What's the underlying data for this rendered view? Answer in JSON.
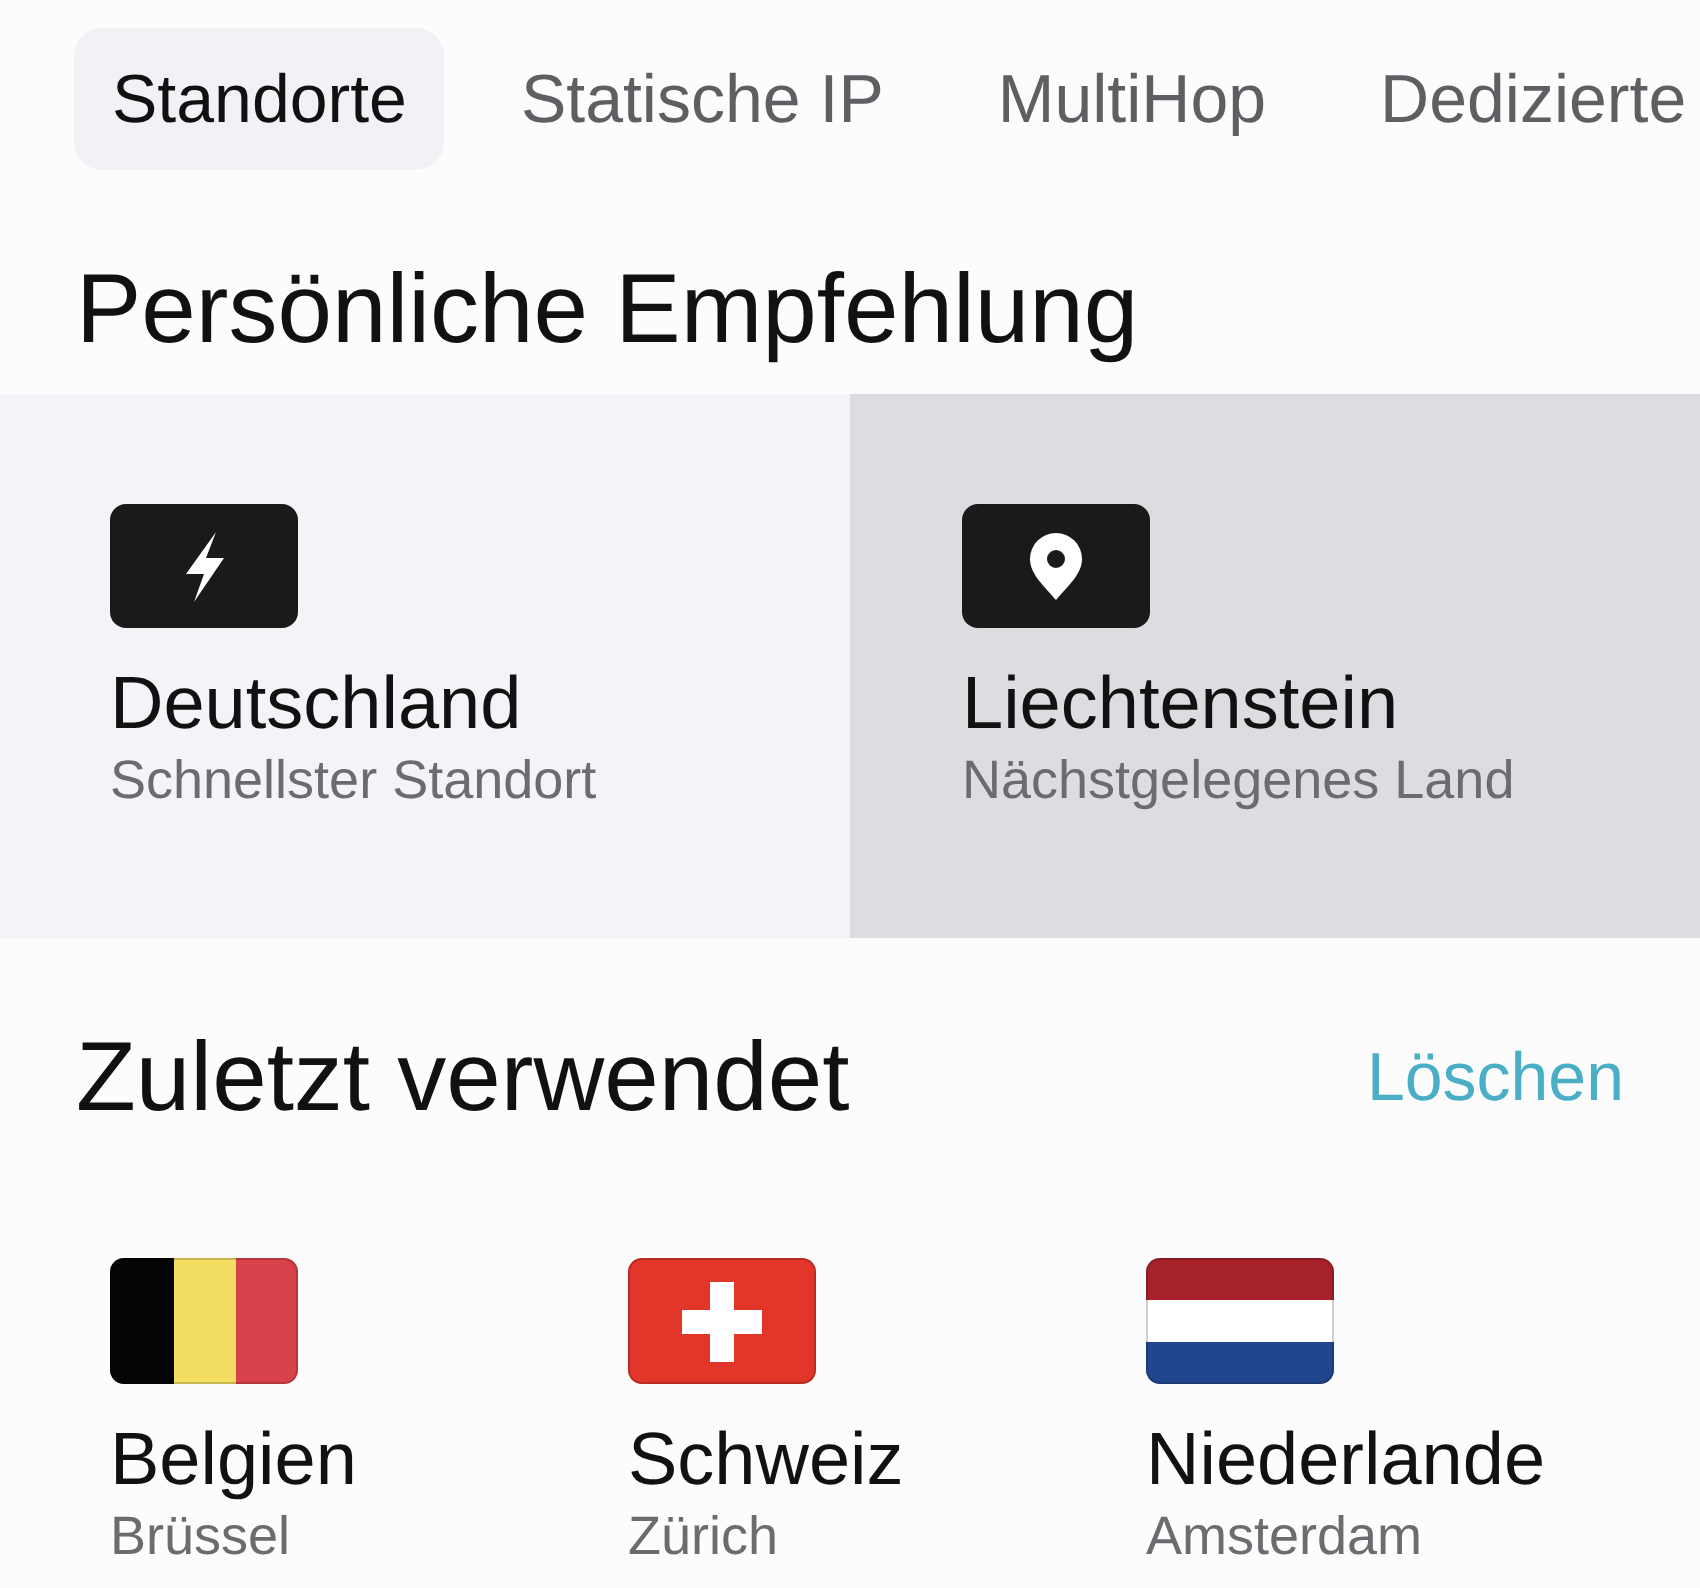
{
  "tabs": [
    {
      "label": "Standorte",
      "selected": true
    },
    {
      "label": "Statische IP",
      "selected": false
    },
    {
      "label": "MultiHop",
      "selected": false
    },
    {
      "label": "Dedizierte",
      "selected": false
    }
  ],
  "recommendation": {
    "title": "Persönliche Empfehlung",
    "cards": [
      {
        "kind": "bolt",
        "name": "Deutschland",
        "subtitle": "Schnellster Standort",
        "selected": false
      },
      {
        "kind": "pin",
        "name": "Liechtenstein",
        "subtitle": "Nächstgelegenes Land",
        "selected": true
      }
    ]
  },
  "recent": {
    "title": "Zuletzt verwendet",
    "clear_label": "Löschen",
    "items": [
      {
        "kind": "belgium",
        "country": "Belgien",
        "city": "Brüssel"
      },
      {
        "kind": "switzerland",
        "country": "Schweiz",
        "city": "Zürich"
      },
      {
        "kind": "netherlands",
        "country": "Niederlande",
        "city": "Amsterdam"
      }
    ]
  }
}
